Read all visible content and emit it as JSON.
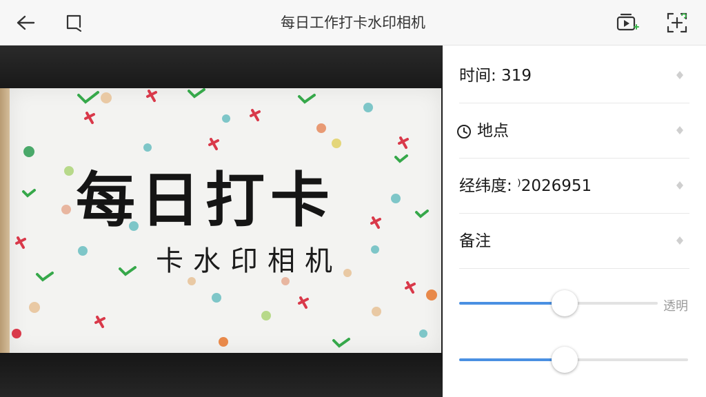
{
  "app": {
    "title": "每日工作打卡水印相机"
  },
  "toolbar": {
    "back_icon": "back-arrow-icon",
    "crop_icon": "crop-icon",
    "video_icon": "video-play-icon",
    "scan_icon": "scan-frame-icon"
  },
  "photo": {
    "card_title": "每日打卡",
    "card_subtitle": "卡水印相机"
  },
  "settings": {
    "items": [
      {
        "label": "时间: 319"
      },
      {
        "label": "地点"
      },
      {
        "label": "经纬度: ⁾2026951"
      },
      {
        "label": "备注"
      }
    ],
    "opacity_label": "透明",
    "opacity_value": 0.53,
    "size_value": 0.46
  },
  "colors": {
    "accent": "#4a90e2",
    "topbar_bg": "#f7f7f7"
  }
}
